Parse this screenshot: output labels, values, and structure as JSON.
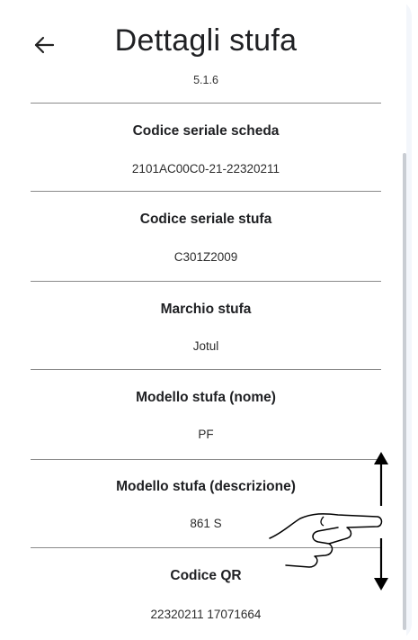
{
  "header": {
    "title": "Dettagli stufa",
    "version": "5.1.6"
  },
  "details": [
    {
      "label": "Codice seriale scheda",
      "value": "2101AC00C0-21-22320211"
    },
    {
      "label": "Codice seriale stufa",
      "value": "C301Z2009"
    },
    {
      "label": "Marchio stufa",
      "value": "Jotul"
    },
    {
      "label": "Modello stufa (nome)",
      "value": "PF"
    },
    {
      "label": "Modello stufa (descrizione)",
      "value": "861 S"
    },
    {
      "label": "Codice QR",
      "value": "22320211 17071664"
    }
  ],
  "icons": {
    "back": "arrow-left-icon",
    "gesture": "swipe-vertical-gesture-icon"
  },
  "colors": {
    "accent": "#4a78d8",
    "divider": "#8a8a8a",
    "scrollbar": "#c9cdd3"
  }
}
